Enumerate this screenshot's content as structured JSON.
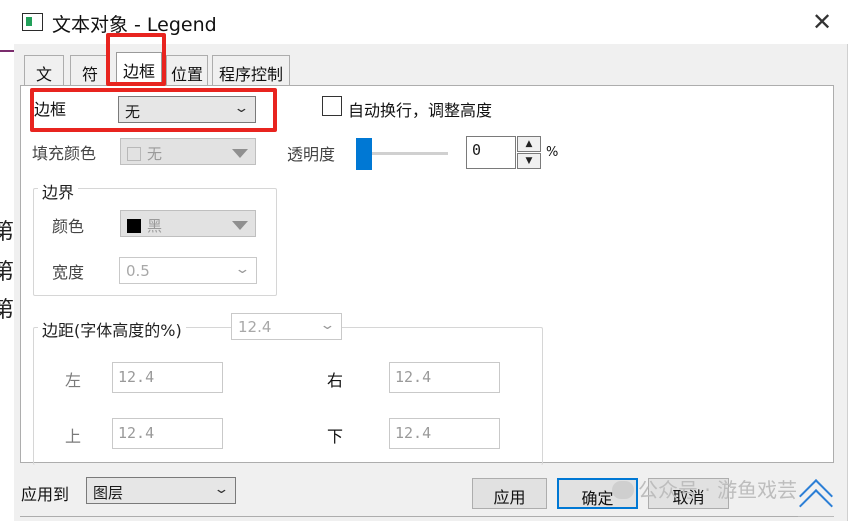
{
  "window": {
    "title": "文本对象 - Legend",
    "icon": "app-window-icon",
    "close_icon": "close-icon"
  },
  "background_glyphs": [
    "第",
    "第",
    "第"
  ],
  "tabs": [
    {
      "label": "文本",
      "active": false
    },
    {
      "label": "符号",
      "active": false
    },
    {
      "label": "边框",
      "active": true
    },
    {
      "label": "位置",
      "active": false
    },
    {
      "label": "程序控制",
      "active": false
    }
  ],
  "border_tab": {
    "border_label": "边框",
    "border_value": "无",
    "autowrap_label": "自动换行，调整高度",
    "autowrap_checked": false,
    "fill_label": "填充颜色",
    "fill_value": "无",
    "transparency_label": "透明度",
    "transparency_value": "0",
    "transparency_unit": "%",
    "edge_group": {
      "title": "边界",
      "color_label": "颜色",
      "color_value": "黑",
      "color_swatch": "#000000",
      "width_label": "宽度",
      "width_value": "0.5"
    },
    "margin_group": {
      "title": "边距(字体高度的%)",
      "all_value": "12.4",
      "left_label": "左",
      "left_value": "12.4",
      "right_label": "右",
      "right_value": "12.4",
      "top_label": "上",
      "top_value": "12.4",
      "bottom_label": "下",
      "bottom_value": "12.4"
    }
  },
  "footer": {
    "apply_to_label": "应用到",
    "apply_to_value": "图层",
    "apply_button": "应用",
    "ok_button": "确定",
    "cancel_button": "取消"
  },
  "watermark": {
    "text": "公众号 · 游鱼戏芸"
  },
  "colors": {
    "accent": "#0078d4",
    "highlight": "#e8241f"
  }
}
